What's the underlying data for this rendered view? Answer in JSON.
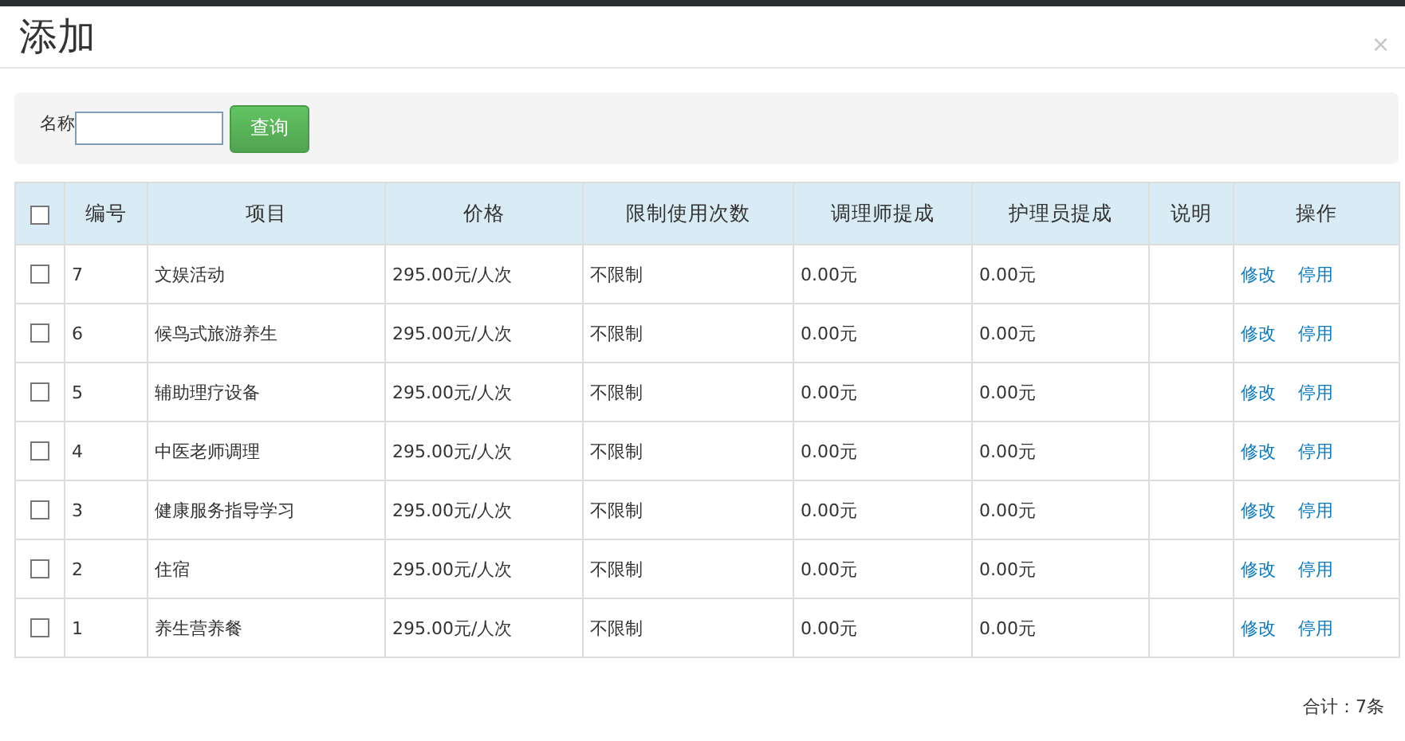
{
  "dialog": {
    "title": "添加",
    "close": "×"
  },
  "search": {
    "label": "名称",
    "button": "查询"
  },
  "table": {
    "select_all": {
      "checked": false
    },
    "columns": [
      "编号",
      "项目",
      "价格",
      "限制使用次数",
      "调理师提成",
      "护理员提成",
      "说明",
      "操作"
    ],
    "rows": [
      {
        "checked": false,
        "id": "7",
        "item": "文娱活动",
        "price": "295.00元/人次",
        "limit": "不限制",
        "therapist": "0.00元",
        "caregiver": "0.00元",
        "actions": [
          "修改",
          "停用"
        ]
      },
      {
        "checked": false,
        "id": "6",
        "item": "候鸟式旅游养生",
        "price": "295.00元/人次",
        "limit": "不限制",
        "therapist": "0.00元",
        "caregiver": "0.00元",
        "actions": [
          "修改",
          "停用"
        ]
      },
      {
        "checked": false,
        "id": "5",
        "item": "辅助理疗设备",
        "price": "295.00元/人次",
        "limit": "不限制",
        "therapist": "0.00元",
        "caregiver": "0.00元",
        "actions": [
          "修改",
          "停用"
        ]
      },
      {
        "checked": false,
        "id": "4",
        "item": "中医老师调理",
        "price": "295.00元/人次",
        "limit": "不限制",
        "therapist": "0.00元",
        "caregiver": "0.00元",
        "actions": [
          "修改",
          "停用"
        ]
      },
      {
        "checked": false,
        "id": "3",
        "item": "健康服务指导学习",
        "price": "295.00元/人次",
        "limit": "不限制",
        "therapist": "0.00元",
        "caregiver": "0.00元",
        "actions": [
          "修改",
          "停用"
        ]
      },
      {
        "checked": false,
        "id": "2",
        "item": "住宿",
        "price": "295.00元/人次",
        "limit": "不限制",
        "therapist": "0.00元",
        "caregiver": "0.00元",
        "actions": [
          "修改",
          "停用"
        ]
      },
      {
        "checked": false,
        "id": "1",
        "item": "养生营养餐",
        "price": "295.00元/人次",
        "limit": "不限制",
        "therapist": "0.00元",
        "caregiver": "0.00元",
        "actions": [
          "修改",
          "停用"
        ]
      }
    ]
  },
  "total": "合计：7条"
}
